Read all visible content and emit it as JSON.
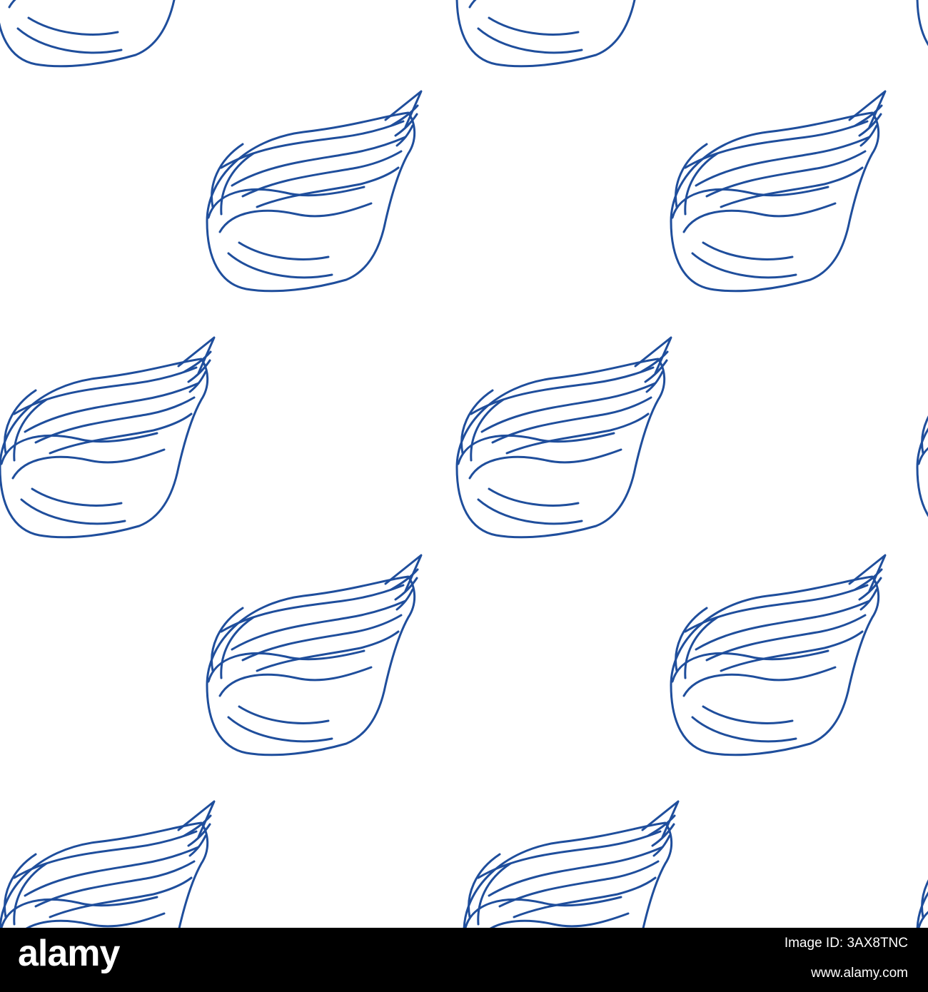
{
  "pattern": {
    "motif": "seashell",
    "line_color": "#1f4e9c",
    "background_color": "#ffffff"
  },
  "watermark": {
    "logo_text": "alamy",
    "image_id_line": "Image ID: 3AX8TNC",
    "url_line": "www.alamy.com",
    "bar_color": "#000000"
  }
}
